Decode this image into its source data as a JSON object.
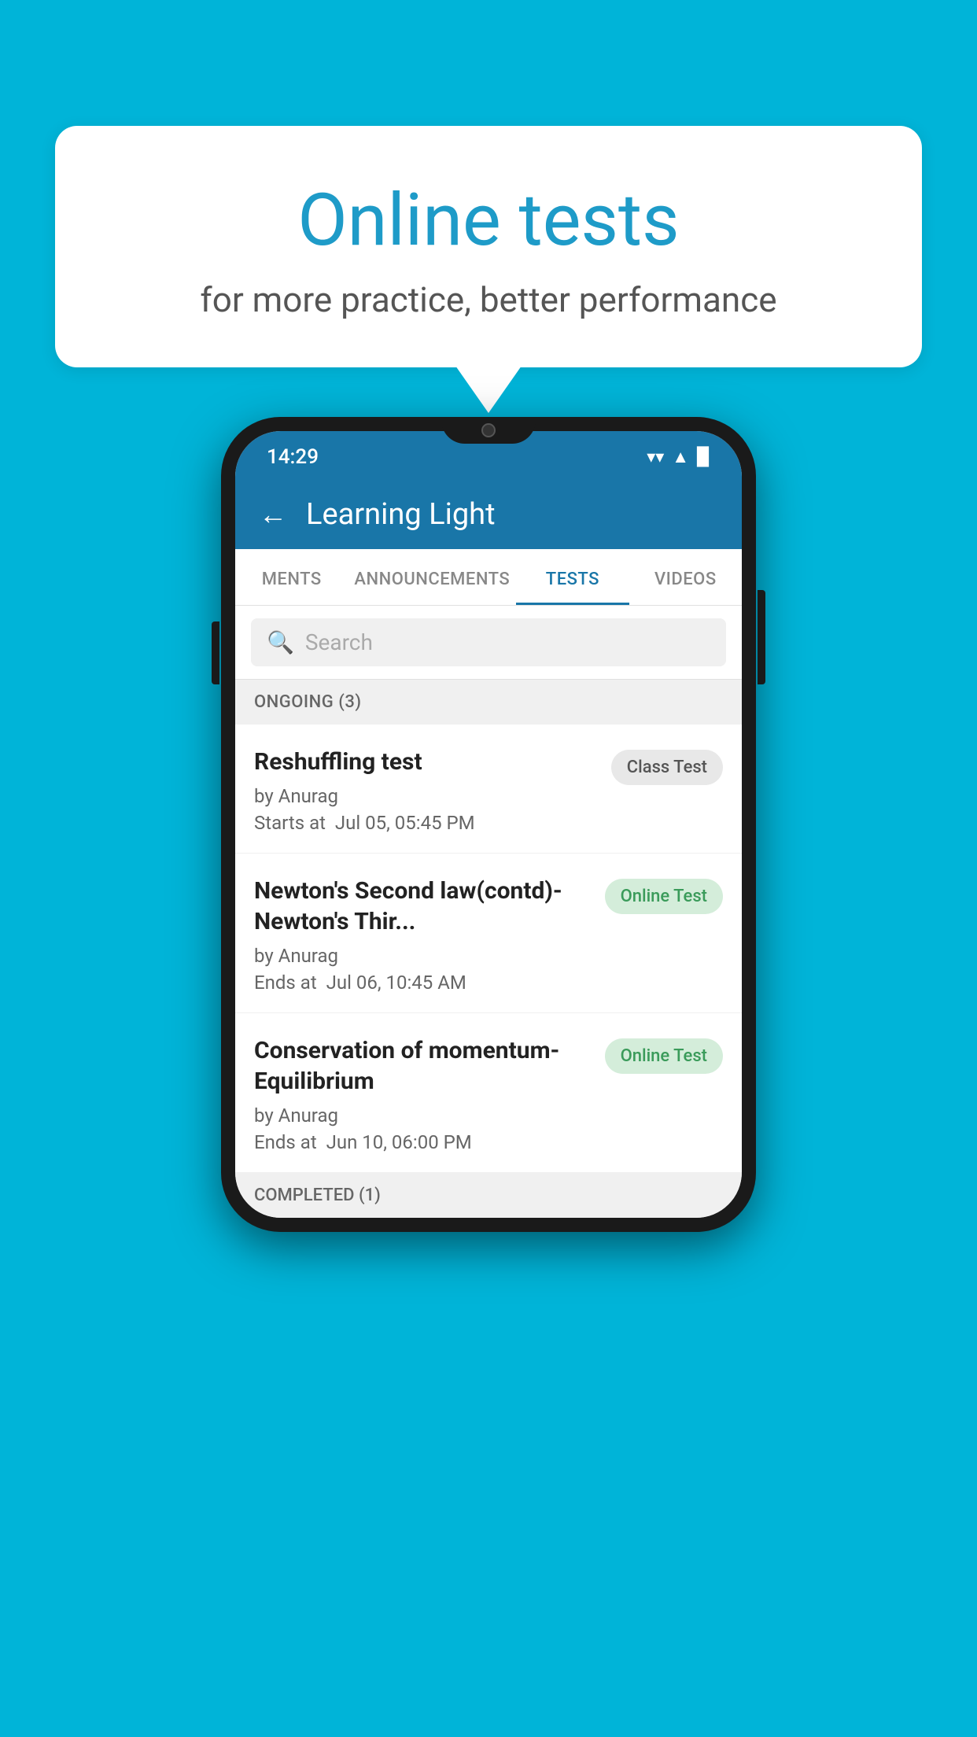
{
  "background_color": "#00B4D8",
  "promo": {
    "title": "Online tests",
    "subtitle": "for more practice, better performance"
  },
  "status_bar": {
    "time": "14:29",
    "wifi": "▾",
    "signal": "▲",
    "battery": "▉"
  },
  "app_bar": {
    "back_label": "←",
    "title": "Learning Light"
  },
  "tabs": [
    {
      "label": "MENTS",
      "active": false
    },
    {
      "label": "ANNOUNCEMENTS",
      "active": false
    },
    {
      "label": "TESTS",
      "active": true
    },
    {
      "label": "VIDEOS",
      "active": false
    }
  ],
  "search": {
    "placeholder": "Search"
  },
  "ongoing_section": {
    "title": "ONGOING (3)"
  },
  "tests": [
    {
      "name": "Reshuffling test",
      "by": "by Anurag",
      "date_label": "Starts at",
      "date": "Jul 05, 05:45 PM",
      "badge": "Class Test",
      "badge_type": "class"
    },
    {
      "name": "Newton's Second law(contd)-Newton's Thir...",
      "by": "by Anurag",
      "date_label": "Ends at",
      "date": "Jul 06, 10:45 AM",
      "badge": "Online Test",
      "badge_type": "online"
    },
    {
      "name": "Conservation of momentum-Equilibrium",
      "by": "by Anurag",
      "date_label": "Ends at",
      "date": "Jun 10, 06:00 PM",
      "badge": "Online Test",
      "badge_type": "online"
    }
  ],
  "completed_section": {
    "title": "COMPLETED (1)"
  }
}
